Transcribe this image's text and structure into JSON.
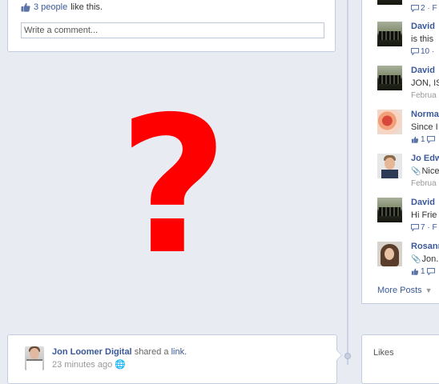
{
  "story_top": {
    "likes_count_link": "3 people",
    "likes_suffix": "like this.",
    "comment_placeholder": "Write a comment..."
  },
  "overlay": {
    "symbol": "?",
    "color": "#ff0000"
  },
  "story_bottom": {
    "author": "Jon Loomer Digital",
    "action": "shared a",
    "object_link": "link.",
    "time": "23 minutes ago"
  },
  "recent_posts": {
    "items": [
      {
        "name": "",
        "text": "",
        "meta": "2 · F",
        "date": "",
        "pic": "team"
      },
      {
        "name": "David",
        "text": "is this",
        "meta": "10 ·",
        "date": "",
        "pic": "team"
      },
      {
        "name": "David",
        "text": "JON, IS",
        "meta": "",
        "date": "Februa",
        "pic": "team"
      },
      {
        "name": "Norma",
        "text": "Since I",
        "meta": "1",
        "date": "",
        "pic": "flowers"
      },
      {
        "name": "Jo Edw",
        "text": "Nice",
        "meta": "",
        "date": "Februa",
        "pic": "person"
      },
      {
        "name": "David",
        "text": "Hi Frie",
        "meta": "7 · F",
        "date": "",
        "pic": "team"
      },
      {
        "name": "Rosann",
        "text": "Jon...",
        "meta": "1",
        "date": "",
        "pic": "woman"
      }
    ],
    "more_label": "More Posts"
  },
  "likes_box": {
    "title": "Likes"
  },
  "colors": {
    "link": "#3b5998",
    "background": "#e9ebf2",
    "border": "#c4cde0"
  }
}
